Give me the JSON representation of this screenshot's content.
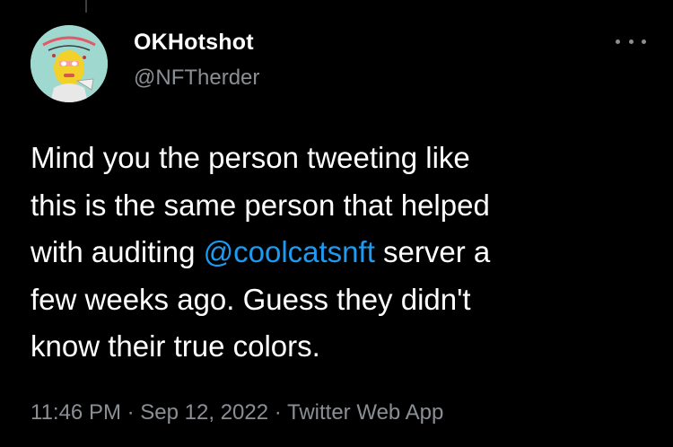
{
  "tweet": {
    "author": {
      "display_name": "OKHotshot",
      "handle": "@NFTherder"
    },
    "body": {
      "line1": "Mind you the person tweeting like",
      "line2": "this is the same person that helped",
      "line3_before": "with auditing ",
      "line3_mention": "@coolcatsnft",
      "line3_after": " server a",
      "line4": "few weeks ago. Guess they didn't",
      "line5": "know their true colors."
    },
    "meta": {
      "time": "11:46 PM",
      "separator": "·",
      "date": "Sep 12, 2022",
      "source": "Twitter Web App"
    }
  },
  "icons": {
    "more": "more-horizontal-icon"
  },
  "colors": {
    "background": "#000000",
    "text_primary": "#ffffff",
    "text_secondary": "#8b8f94",
    "link": "#1d9bf0"
  }
}
